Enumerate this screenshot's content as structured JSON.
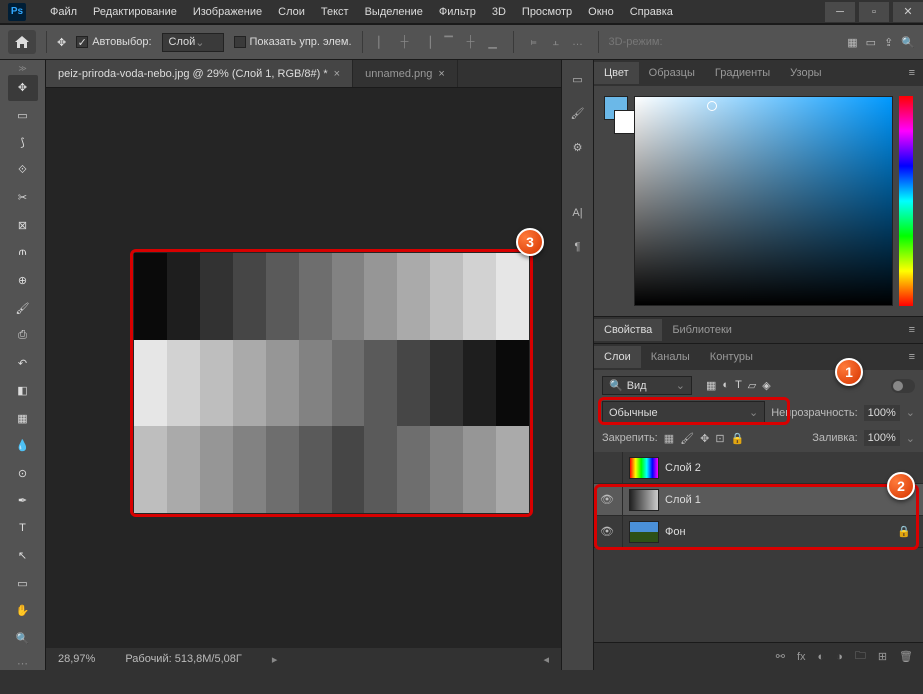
{
  "app": {
    "logo": "Ps"
  },
  "menu": [
    "Файл",
    "Редактирование",
    "Изображение",
    "Слои",
    "Текст",
    "Выделение",
    "Фильтр",
    "3D",
    "Просмотр",
    "Окно",
    "Справка"
  ],
  "options": {
    "autoselect": "Автовыбор:",
    "layer_select": "Слой",
    "show_controls": "Показать упр. элем.",
    "mode3d": "3D-режим:"
  },
  "tabs": [
    {
      "title": "peiz-priroda-voda-nebo.jpg @ 29% (Слой 1, RGB/8#) *",
      "active": true
    },
    {
      "title": "unnamed.png",
      "active": false
    }
  ],
  "status": {
    "zoom": "28,97%",
    "doc": "Рабочий: 513,8M/5,08Г"
  },
  "color_tabs": [
    "Цвет",
    "Образцы",
    "Градиенты",
    "Узоры"
  ],
  "props_tabs": [
    "Свойства",
    "Библиотеки"
  ],
  "layers_tabs": [
    "Слои",
    "Каналы",
    "Контуры"
  ],
  "layers_panel": {
    "search": "Вид",
    "blend_mode": "Обычные",
    "opacity_label": "Непрозрачность:",
    "opacity_val": "100%",
    "lock_label": "Закрепить:",
    "fill_label": "Заливка:",
    "fill_val": "100%",
    "items": [
      {
        "name": "Слой 2",
        "visible": false,
        "locked": false,
        "thumb": "rainbow"
      },
      {
        "name": "Слой 1",
        "visible": true,
        "locked": false,
        "thumb": "gray"
      },
      {
        "name": "Фон",
        "visible": true,
        "locked": true,
        "thumb": "photo"
      }
    ]
  },
  "callouts": {
    "c1": "1",
    "c2": "2",
    "c3": "3"
  },
  "gradient_rows": [
    [
      "#0a0a0a",
      "#1e1e1e",
      "#323232",
      "#464646",
      "#5a5a5a",
      "#6e6e6e",
      "#828282",
      "#969696",
      "#aaaaaa",
      "#bebebe",
      "#d2d2d2",
      "#e6e6e6"
    ],
    [
      "#e6e6e6",
      "#d2d2d2",
      "#bebebe",
      "#aaaaaa",
      "#969696",
      "#828282",
      "#6e6e6e",
      "#5a5a5a",
      "#464646",
      "#323232",
      "#1e1e1e",
      "#0a0a0a"
    ],
    [
      "#bebebe",
      "#aaaaaa",
      "#969696",
      "#828282",
      "#6e6e6e",
      "#5a5a5a",
      "#464646",
      "#5a5a5a",
      "#6e6e6e",
      "#828282",
      "#969696",
      "#aaaaaa"
    ]
  ]
}
